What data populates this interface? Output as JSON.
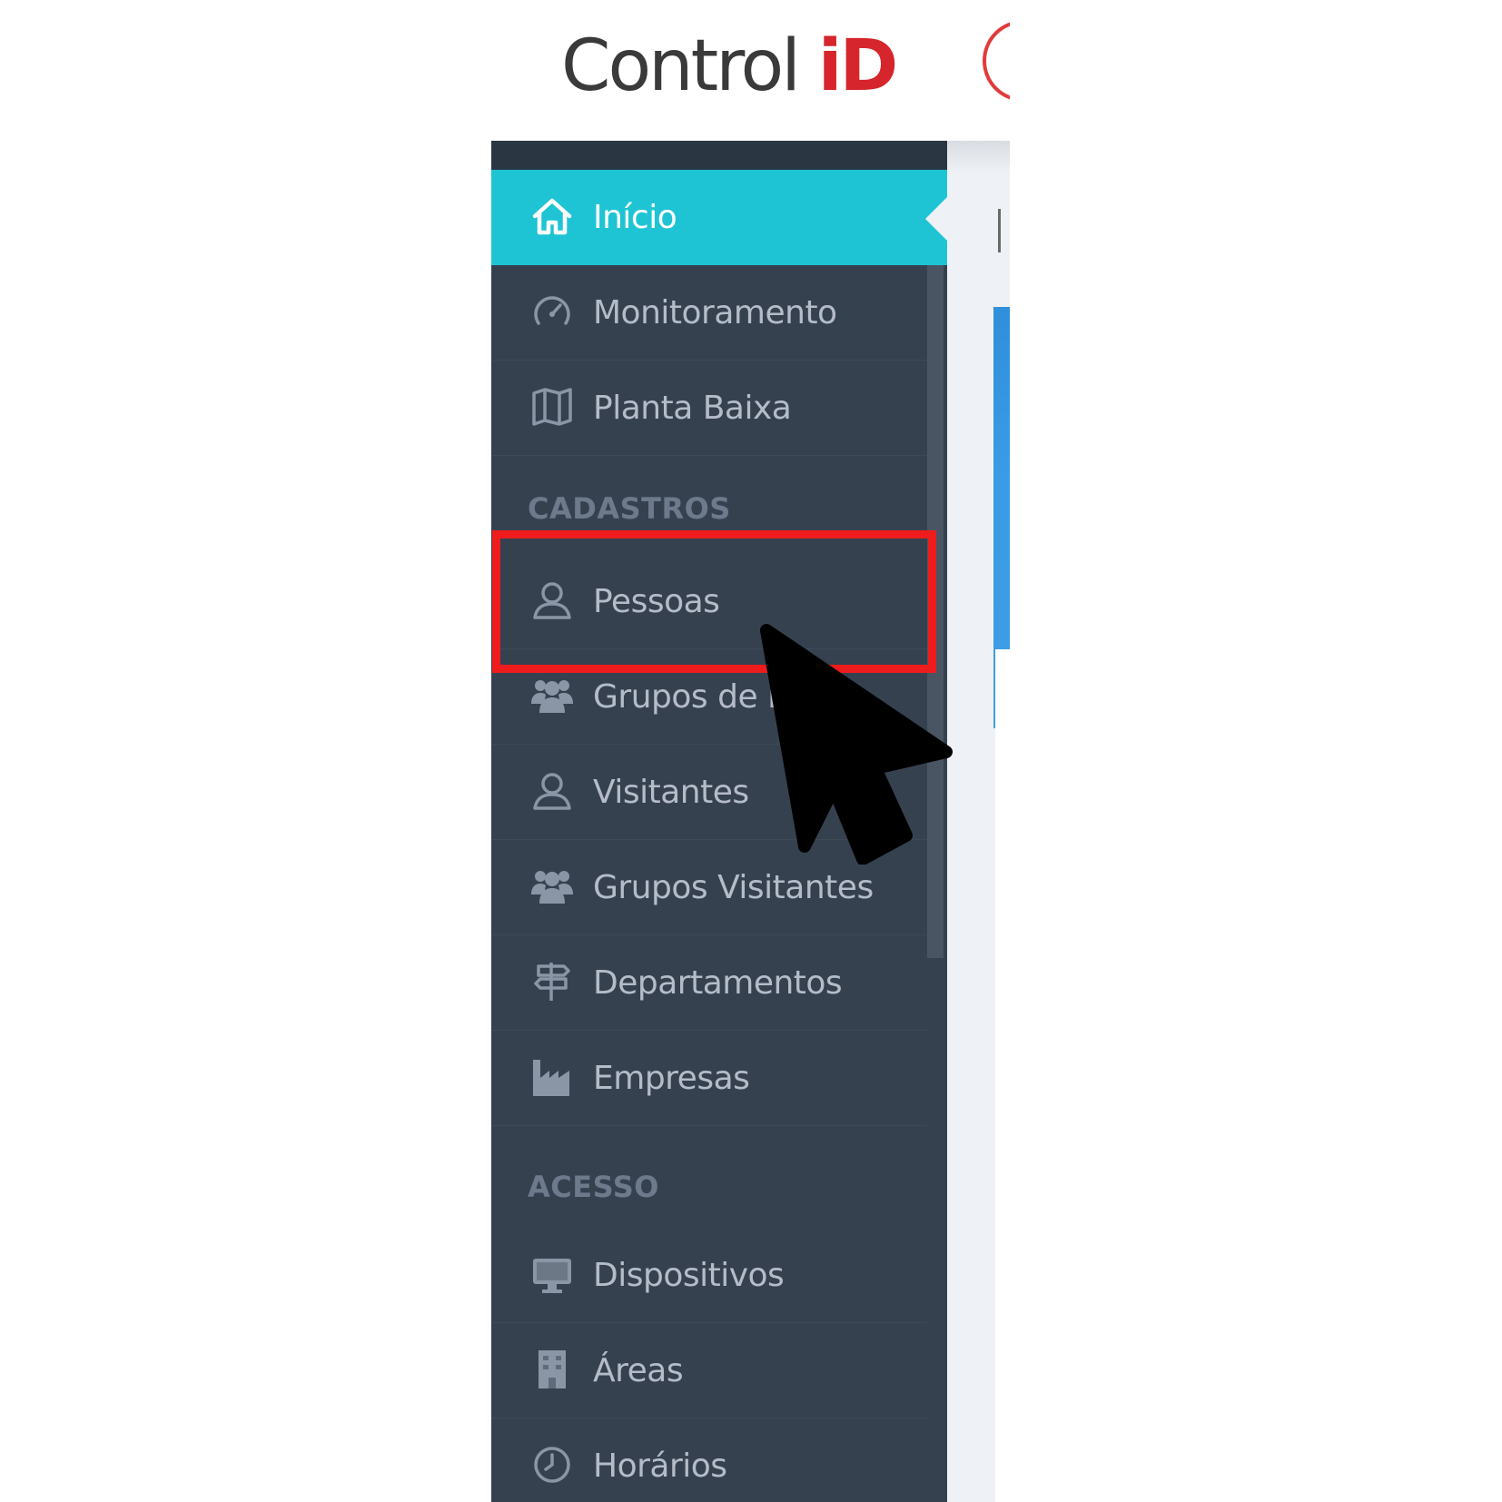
{
  "header": {
    "logo_text": "Control",
    "logo_accent": "iD"
  },
  "colors": {
    "sidebar_bg": "#364150",
    "active_item_bg": "#1ec4d4",
    "highlight_box": "#ee1c1c",
    "brand_red": "#d6252c",
    "content_blue": "#3a9be6"
  },
  "sidebar": {
    "items": [
      {
        "label": "Início",
        "icon": "home-icon",
        "active": true
      },
      {
        "label": "Monitoramento",
        "icon": "dashboard-gauge-icon"
      },
      {
        "label": "Planta Baixa",
        "icon": "map-icon"
      }
    ],
    "sections": [
      {
        "heading": "CADASTROS",
        "items": [
          {
            "label": "Pessoas",
            "icon": "user-icon",
            "highlighted": true
          },
          {
            "label": "Grupos de P",
            "icon": "users-group-icon"
          },
          {
            "label": "Visitantes",
            "icon": "user-icon"
          },
          {
            "label": "Grupos Visitantes",
            "icon": "users-group-icon"
          },
          {
            "label": "Departamentos",
            "icon": "signpost-icon"
          },
          {
            "label": "Empresas",
            "icon": "factory-icon"
          }
        ]
      },
      {
        "heading": "ACESSO",
        "items": [
          {
            "label": "Dispositivos",
            "icon": "monitor-icon"
          },
          {
            "label": "Áreas",
            "icon": "building-icon"
          },
          {
            "label": "Horários",
            "icon": "clock-icon"
          }
        ]
      }
    ]
  }
}
